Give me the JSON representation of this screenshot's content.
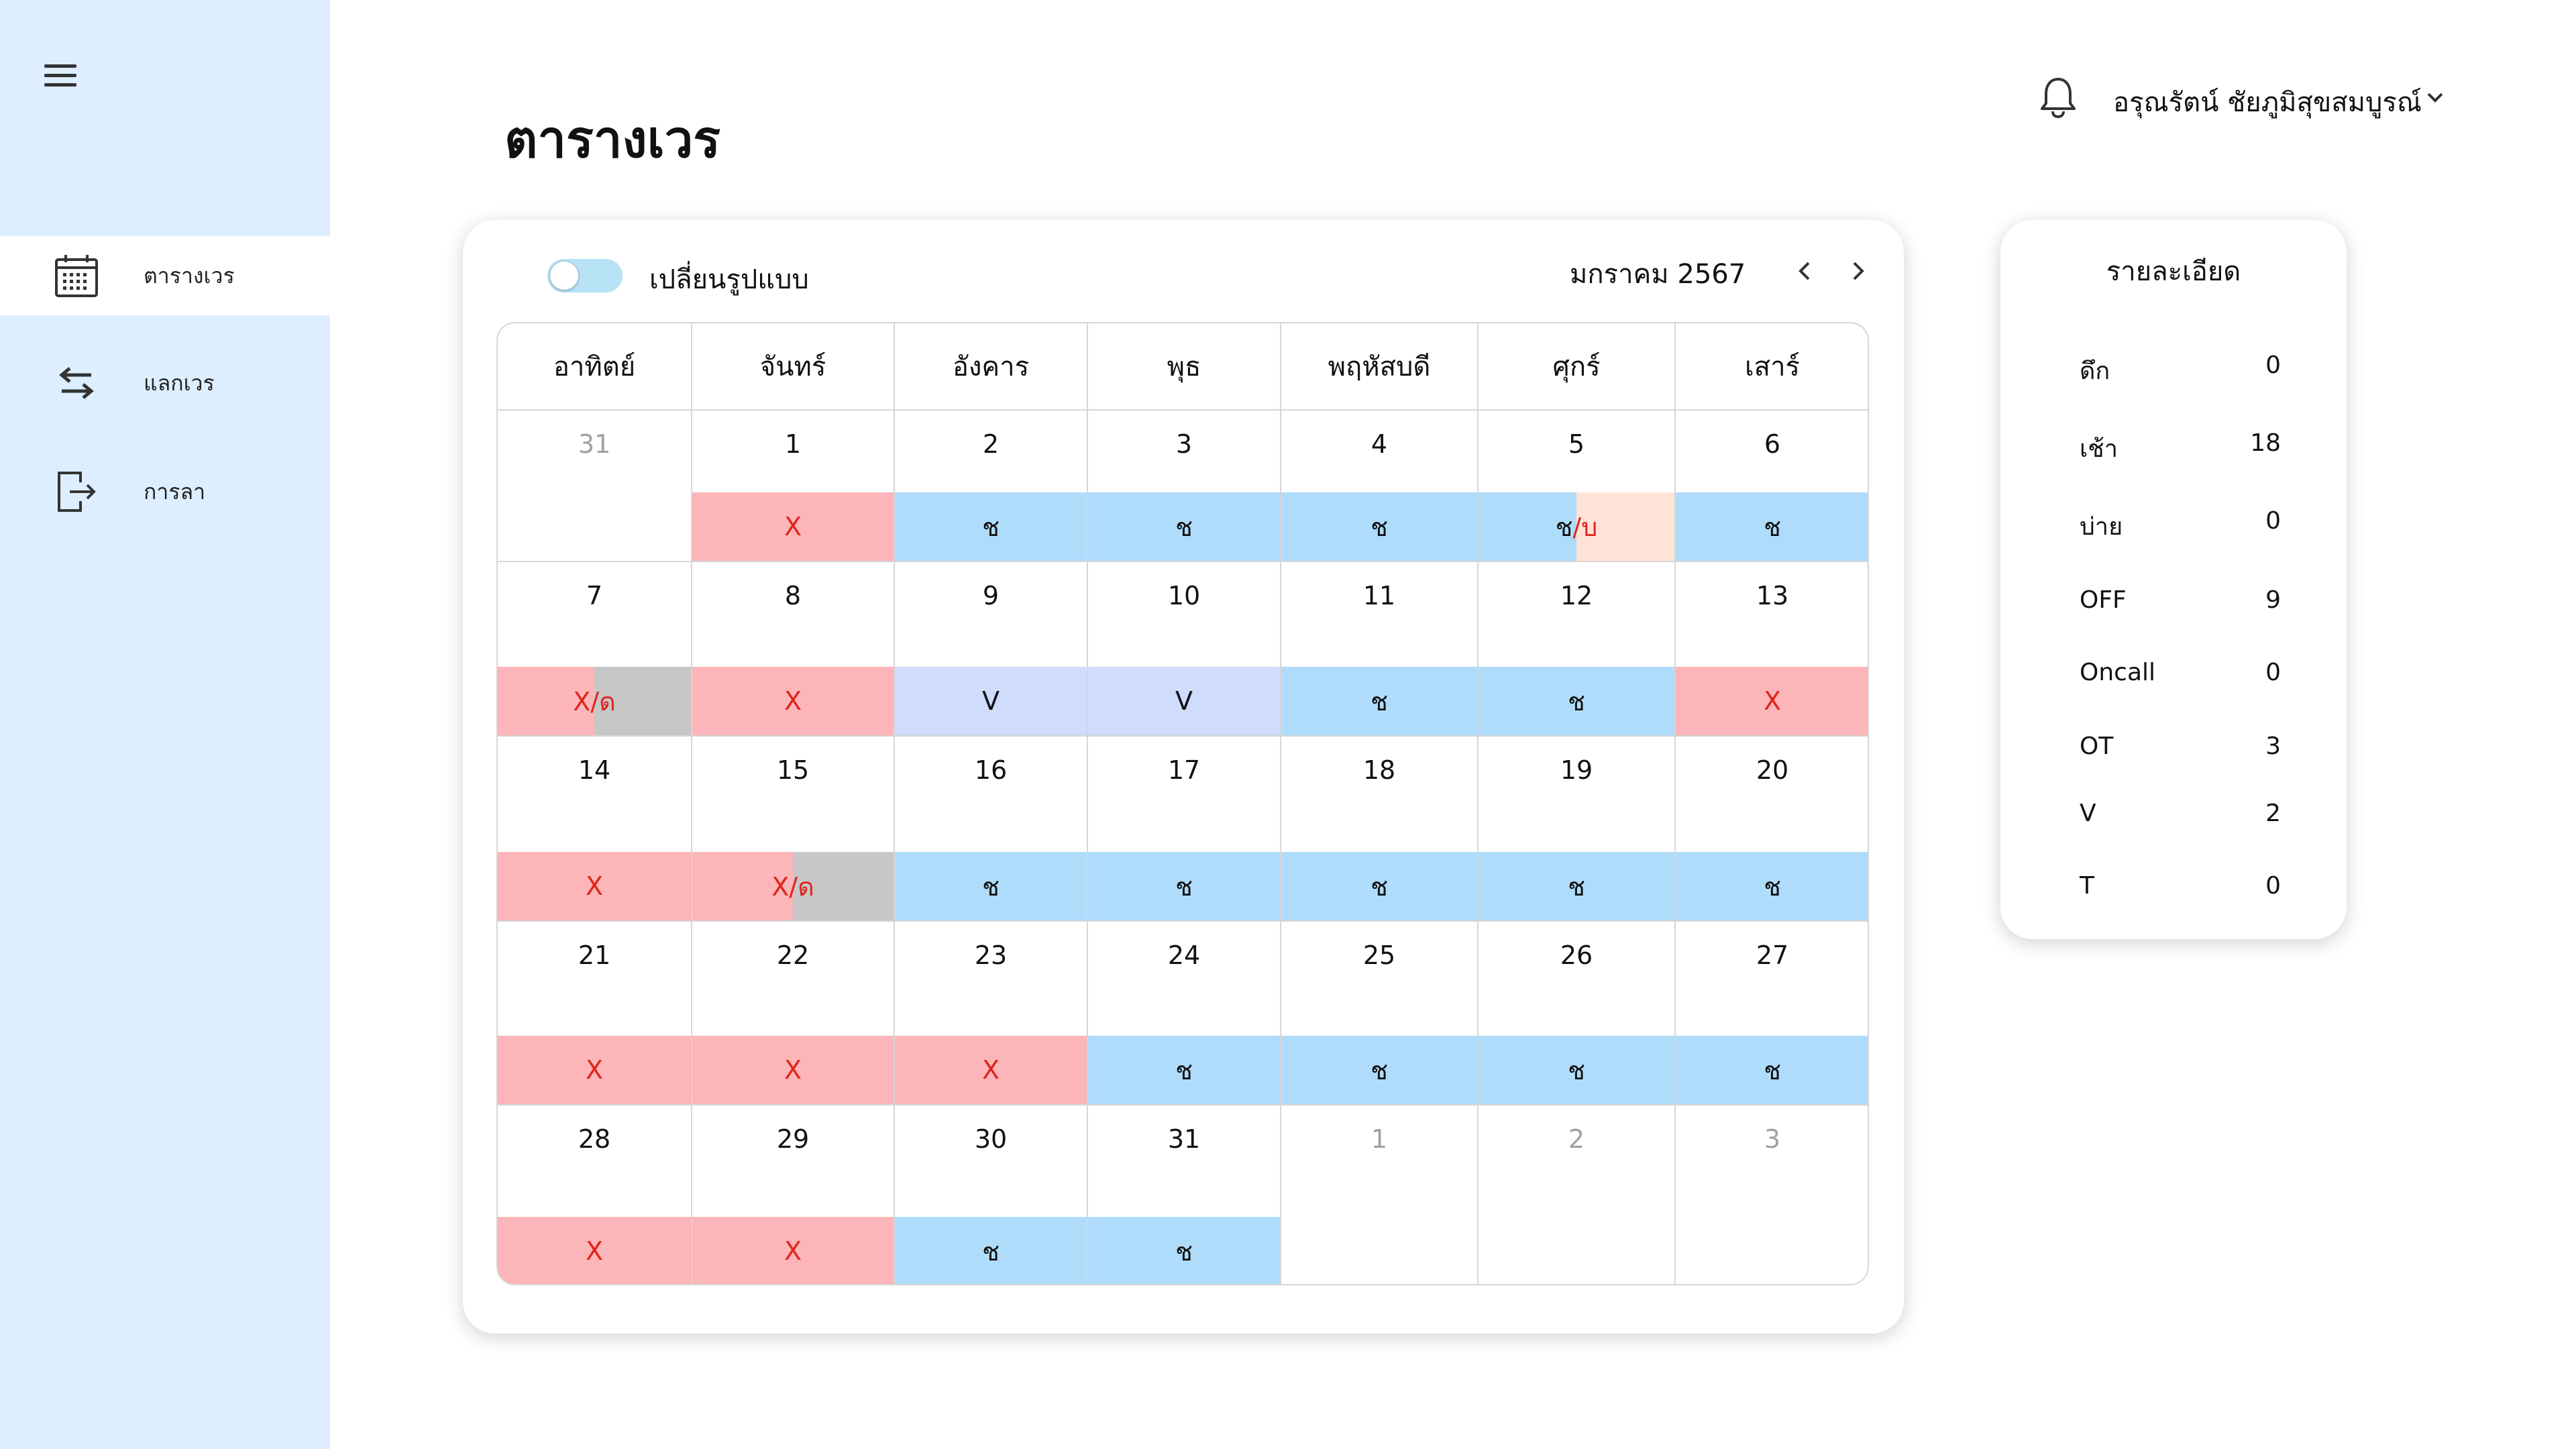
{
  "sidebar": {
    "items": [
      {
        "label": "ตารางเวร",
        "icon": "calendar-icon"
      },
      {
        "label": "แลกเวร",
        "icon": "swap-arrows-icon"
      },
      {
        "label": "การลา",
        "icon": "logout-icon"
      }
    ],
    "menu_icon": "hamburger-icon"
  },
  "header": {
    "title": "ตารางเวร",
    "user_name": "อรุณรัตน์ ชัยภูมิสุขสมบูรณ์",
    "bell_icon": "bell-icon",
    "chevron_icon": "chevron-down-icon"
  },
  "calendar": {
    "toggle_label": "เปลี่ยนรูปแบบ",
    "month_label": "มกราคม  2567",
    "weekdays": [
      "อาทิตย์",
      "จันทร์",
      "อังคาร",
      "พุธ",
      "พฤหัสบดี",
      "ศุกร์",
      "เสาร์"
    ],
    "colors": {
      "x": "#fcb5b8",
      "morning": "#afdcfb",
      "v": "#d0dcfb",
      "gray": "#c7c7c7",
      "afternoon": "#fee3d6",
      "red_text": "#e0241c"
    },
    "weeks": [
      [
        {
          "day": "31",
          "muted": true,
          "shift": null
        },
        {
          "day": "1",
          "shift": {
            "type": "x",
            "text": "X"
          }
        },
        {
          "day": "2",
          "shift": {
            "type": "morning",
            "text": "ช"
          }
        },
        {
          "day": "3",
          "shift": {
            "type": "morning",
            "text": "ช"
          }
        },
        {
          "day": "4",
          "shift": {
            "type": "morning",
            "text": "ช"
          }
        },
        {
          "day": "5",
          "shift": {
            "type": "split-mb",
            "text1": "ช",
            "text2": "/บ"
          }
        },
        {
          "day": "6",
          "shift": {
            "type": "morning",
            "text": "ช"
          }
        }
      ],
      [
        {
          "day": "7",
          "shift": {
            "type": "split-xd",
            "text": "X/ด"
          }
        },
        {
          "day": "8",
          "shift": {
            "type": "x",
            "text": "X"
          }
        },
        {
          "day": "9",
          "shift": {
            "type": "v",
            "text": "V"
          }
        },
        {
          "day": "10",
          "shift": {
            "type": "v",
            "text": "V"
          }
        },
        {
          "day": "11",
          "shift": {
            "type": "morning",
            "text": "ช"
          }
        },
        {
          "day": "12",
          "shift": {
            "type": "morning",
            "text": "ช"
          }
        },
        {
          "day": "13",
          "shift": {
            "type": "x",
            "text": "X"
          }
        }
      ],
      [
        {
          "day": "14",
          "shift": {
            "type": "x",
            "text": "X"
          }
        },
        {
          "day": "15",
          "shift": {
            "type": "split-xd",
            "text": "X/ด"
          }
        },
        {
          "day": "16",
          "shift": {
            "type": "morning",
            "text": "ช"
          }
        },
        {
          "day": "17",
          "shift": {
            "type": "morning",
            "text": "ช"
          }
        },
        {
          "day": "18",
          "shift": {
            "type": "morning",
            "text": "ช"
          }
        },
        {
          "day": "19",
          "shift": {
            "type": "morning",
            "text": "ช"
          }
        },
        {
          "day": "20",
          "shift": {
            "type": "morning",
            "text": "ช"
          }
        }
      ],
      [
        {
          "day": "21",
          "shift": {
            "type": "x",
            "text": "X"
          }
        },
        {
          "day": "22",
          "shift": {
            "type": "x",
            "text": "X"
          }
        },
        {
          "day": "23",
          "shift": {
            "type": "x",
            "text": "X"
          }
        },
        {
          "day": "24",
          "shift": {
            "type": "morning",
            "text": "ช"
          }
        },
        {
          "day": "25",
          "shift": {
            "type": "morning",
            "text": "ช"
          }
        },
        {
          "day": "26",
          "shift": {
            "type": "morning",
            "text": "ช"
          }
        },
        {
          "day": "27",
          "shift": {
            "type": "morning",
            "text": "ช"
          }
        }
      ],
      [
        {
          "day": "28",
          "shift": {
            "type": "x",
            "text": "X"
          }
        },
        {
          "day": "29",
          "shift": {
            "type": "x",
            "text": "X"
          }
        },
        {
          "day": "30",
          "shift": {
            "type": "morning",
            "text": "ช"
          }
        },
        {
          "day": "31",
          "shift": {
            "type": "morning",
            "text": "ช"
          }
        },
        {
          "day": "1",
          "muted": true,
          "shift": null
        },
        {
          "day": "2",
          "muted": true,
          "shift": null
        },
        {
          "day": "3",
          "muted": true,
          "shift": null
        }
      ]
    ]
  },
  "details": {
    "title": "รายละเอียด",
    "rows": [
      {
        "label": "ดึก",
        "value": "0"
      },
      {
        "label": "เช้า",
        "value": "18"
      },
      {
        "label": "บ่าย",
        "value": "0"
      },
      {
        "label": "OFF",
        "value": "9"
      },
      {
        "label": "Oncall",
        "value": "0"
      },
      {
        "label": "OT",
        "value": "3"
      },
      {
        "label": "V",
        "value": "2"
      },
      {
        "label": "T",
        "value": "0"
      }
    ]
  }
}
